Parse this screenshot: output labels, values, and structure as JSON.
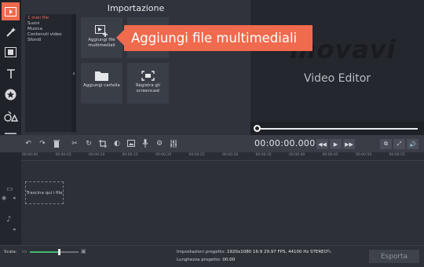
{
  "import": {
    "title": "Importazione",
    "categories": [
      "1 miei file",
      "Suoni",
      "Musica",
      "Contenuti video",
      "Sfondi"
    ],
    "tiles": {
      "add_media": "Aggiungi file multimediali",
      "add_folder": "Aggiungi cartella",
      "record_screencast": "Registra gli screencast"
    }
  },
  "preview": {
    "logo": "movavi",
    "product": "Video Editor",
    "progress": 0.0
  },
  "playback": {
    "timecode": "00:00:00.000"
  },
  "ruler": {
    "labels": [
      "00:00:00",
      "00:00:05",
      "00:00:10",
      "00:00:15",
      "00:00:20",
      "00:00:25",
      "00:00:30",
      "00:00:35",
      "00:00:40",
      "00:00:45",
      "00:00:50",
      "00:00:55"
    ]
  },
  "timeline": {
    "drop_hint": "Trascina qui i file"
  },
  "bottom": {
    "scale_label": "Scala:",
    "scale_level": 0.6,
    "settings_label": "Impostazioni progetto:",
    "settings_value": "1920x1080 16:9 29.97 FPS, 44100 Hz STEREO",
    "length_label": "Lunghezza progetto:",
    "length_value": "00:00",
    "export_label": "Esporta"
  },
  "tooltip": {
    "text": "Aggiungi file multimediali"
  },
  "colors": {
    "accent": "#f06a4e",
    "scale_fill": "#3fb871",
    "panel": "#30333b",
    "preview_bg": "#24272d"
  },
  "icons": {
    "left_toolbar": [
      "import-icon",
      "wand-icon",
      "filmstrip-icon",
      "text-icon",
      "star-icon",
      "shapes-icon",
      "menu-icon"
    ],
    "edit_bar": [
      "undo-icon",
      "redo-icon",
      "delete-icon",
      "cut-icon",
      "rotate-icon",
      "crop-icon",
      "color-icon",
      "media-icon",
      "mic-icon",
      "settings-icon",
      "equalizer-icon"
    ],
    "playback": [
      "prev-icon",
      "play-icon",
      "next-icon",
      "fullscreen-detach-icon",
      "expand-icon",
      "volume-icon"
    ]
  }
}
